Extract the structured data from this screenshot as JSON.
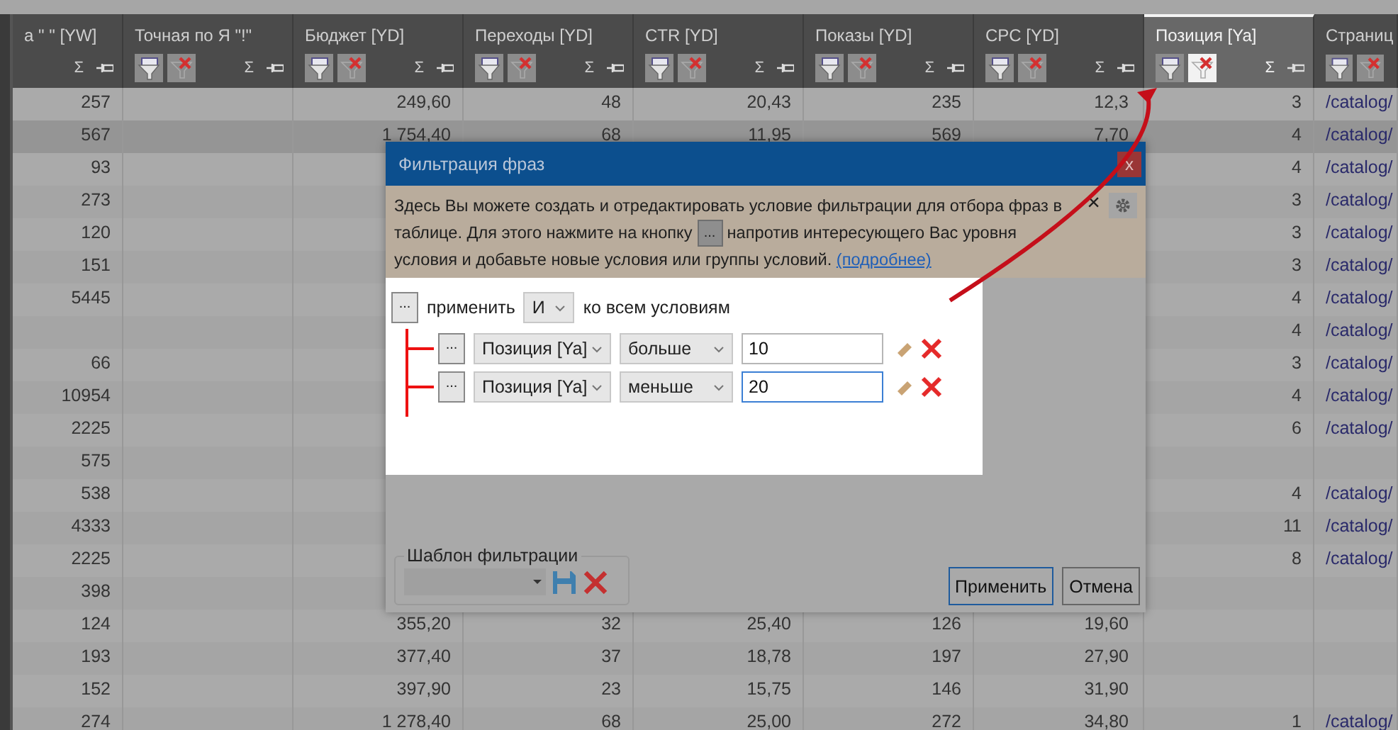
{
  "table": {
    "columns": [
      {
        "title": "а \" \" [YW]",
        "sum": "Σ",
        "icons": false,
        "selected": false
      },
      {
        "title": "Точная по Я \"!\"",
        "sum": "Σ",
        "icons": true,
        "selected": false,
        "filtered": false
      },
      {
        "title": "Бюджет [YD]",
        "sum": "Σ",
        "icons": true,
        "selected": false,
        "filtered": false
      },
      {
        "title": "Переходы [YD]",
        "sum": "Σ",
        "icons": true,
        "selected": false,
        "filtered": false
      },
      {
        "title": "CTR [YD]",
        "sum": "Σ",
        "icons": true,
        "selected": false,
        "filtered": false
      },
      {
        "title": "Показы [YD]",
        "sum": "Σ",
        "icons": true,
        "selected": false,
        "filtered": false
      },
      {
        "title": "CPC [YD]",
        "sum": "Σ",
        "icons": true,
        "selected": false,
        "filtered": false
      },
      {
        "title": "Позиция [Ya]",
        "sum": "Σ",
        "icons": true,
        "selected": true,
        "filtered": true
      },
      {
        "title": "Страниц",
        "icons": true,
        "selected": false,
        "filtered": false
      }
    ],
    "rows": [
      {
        "selected": false,
        "cells": [
          "257",
          null,
          "249,60",
          "48",
          "20,43",
          "235",
          "12,3",
          "3",
          "/catalog/"
        ]
      },
      {
        "selected": true,
        "cells": [
          "567",
          null,
          "1 754,40",
          "68",
          "11,95",
          "569",
          "7,70",
          "4",
          "/catalog/"
        ]
      },
      {
        "selected": false,
        "cells": [
          "93",
          null,
          null,
          null,
          null,
          null,
          null,
          "4",
          "/catalog/"
        ]
      },
      {
        "selected": false,
        "cells": [
          "273",
          null,
          null,
          null,
          null,
          null,
          null,
          "3",
          "/catalog/"
        ]
      },
      {
        "selected": false,
        "cells": [
          "120",
          null,
          null,
          null,
          null,
          null,
          null,
          "3",
          "/catalog/"
        ]
      },
      {
        "selected": false,
        "cells": [
          "151",
          null,
          null,
          null,
          null,
          null,
          null,
          "3",
          "/catalog/"
        ]
      },
      {
        "selected": false,
        "cells": [
          "5445",
          null,
          null,
          null,
          null,
          null,
          null,
          "4",
          "/catalog/"
        ]
      },
      {
        "selected": false,
        "cells": [
          null,
          null,
          null,
          null,
          null,
          null,
          null,
          "4",
          "/catalog/"
        ]
      },
      {
        "selected": false,
        "cells": [
          "66",
          null,
          null,
          null,
          null,
          null,
          null,
          "3",
          "/catalog/"
        ]
      },
      {
        "selected": false,
        "cells": [
          "10954",
          null,
          null,
          null,
          null,
          null,
          null,
          "4",
          "/catalog/"
        ]
      },
      {
        "selected": false,
        "cells": [
          "2225",
          null,
          null,
          null,
          null,
          null,
          null,
          "6",
          "/catalog/"
        ]
      },
      {
        "selected": false,
        "cells": [
          "575",
          null,
          null,
          null,
          null,
          null,
          null,
          null,
          null
        ]
      },
      {
        "selected": false,
        "cells": [
          "538",
          null,
          null,
          null,
          null,
          null,
          null,
          "4",
          "/catalog/"
        ]
      },
      {
        "selected": false,
        "cells": [
          "4333",
          null,
          null,
          null,
          null,
          null,
          null,
          "11",
          "/catalog/"
        ]
      },
      {
        "selected": false,
        "cells": [
          "2225",
          null,
          null,
          null,
          null,
          null,
          null,
          "8",
          "/catalog/"
        ]
      },
      {
        "selected": false,
        "cells": [
          "398",
          null,
          null,
          null,
          null,
          null,
          null,
          null,
          null
        ]
      },
      {
        "selected": false,
        "cells": [
          "124",
          null,
          "355,20",
          "32",
          "25,40",
          "126",
          "19,60",
          null,
          null
        ]
      },
      {
        "selected": false,
        "cells": [
          "193",
          null,
          "377,40",
          "37",
          "18,78",
          "197",
          "27,90",
          null,
          null
        ]
      },
      {
        "selected": false,
        "cells": [
          "152",
          null,
          "397,90",
          "23",
          "15,75",
          "146",
          "31,90",
          null,
          null
        ]
      },
      {
        "selected": false,
        "cells": [
          "274",
          null,
          "1 278,40",
          "68",
          "25,00",
          "272",
          "34,80",
          "1",
          "/catalog/"
        ]
      }
    ]
  },
  "dialog": {
    "title": "Фильтрация фраз",
    "close": "x",
    "info": {
      "text_before": "Здесь Вы можете создать и отредактировать условие фильтрации для отбора фраз в таблице. Для этого нажмите на кнопку",
      "button": "...",
      "text_after": "напротив интересующего Вас уровня условия и добавьте новые условия или группы условий.",
      "link": "(подробнее)",
      "close": "×"
    },
    "group": {
      "button": "...",
      "label_before": "применить",
      "operator": "И",
      "label_after": "ко всем условиям"
    },
    "conditions": [
      {
        "button": "...",
        "field": "Позиция [Ya]",
        "operator": "больше",
        "value": "10",
        "focused": false
      },
      {
        "button": "...",
        "field": "Позиция [Ya]",
        "operator": "меньше",
        "value": "20",
        "focused": true
      }
    ],
    "template": {
      "label": "Шаблон фильтрации"
    },
    "buttons": [
      {
        "label": "Применить",
        "default": true
      },
      {
        "label": "Отмена",
        "default": false
      }
    ]
  }
}
